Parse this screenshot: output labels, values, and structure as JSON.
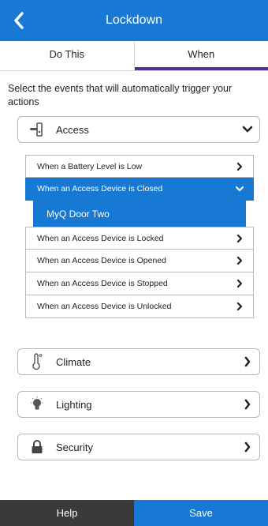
{
  "header": {
    "title": "Lockdown"
  },
  "tabs": [
    {
      "label": "Do This",
      "active": false
    },
    {
      "label": "When",
      "active": true
    }
  ],
  "instruction": "Select the events that will automatically trigger your actions",
  "categories": {
    "access": {
      "label": "Access",
      "icon": "door-lock-icon",
      "expanded": true
    },
    "climate": {
      "label": "Climate",
      "icon": "thermometer-icon"
    },
    "lighting": {
      "label": "Lighting",
      "icon": "lightbulb-icon"
    },
    "security": {
      "label": "Security",
      "icon": "padlock-icon"
    }
  },
  "access_events": [
    "When a Battery Level is Low",
    "When an Access Device is Closed",
    "When an Access Device is Locked",
    "When an Access Device is Opened",
    "When an Access Device is Stopped",
    "When an Access Device is Unlocked"
  ],
  "selected_event_subitem": "MyQ Door Two",
  "footer": {
    "help": "Help",
    "save": "Save"
  },
  "colors": {
    "primary": "#1779d4",
    "tab_indicator": "#5a2d91",
    "footer_dark": "#3a3a3a"
  }
}
